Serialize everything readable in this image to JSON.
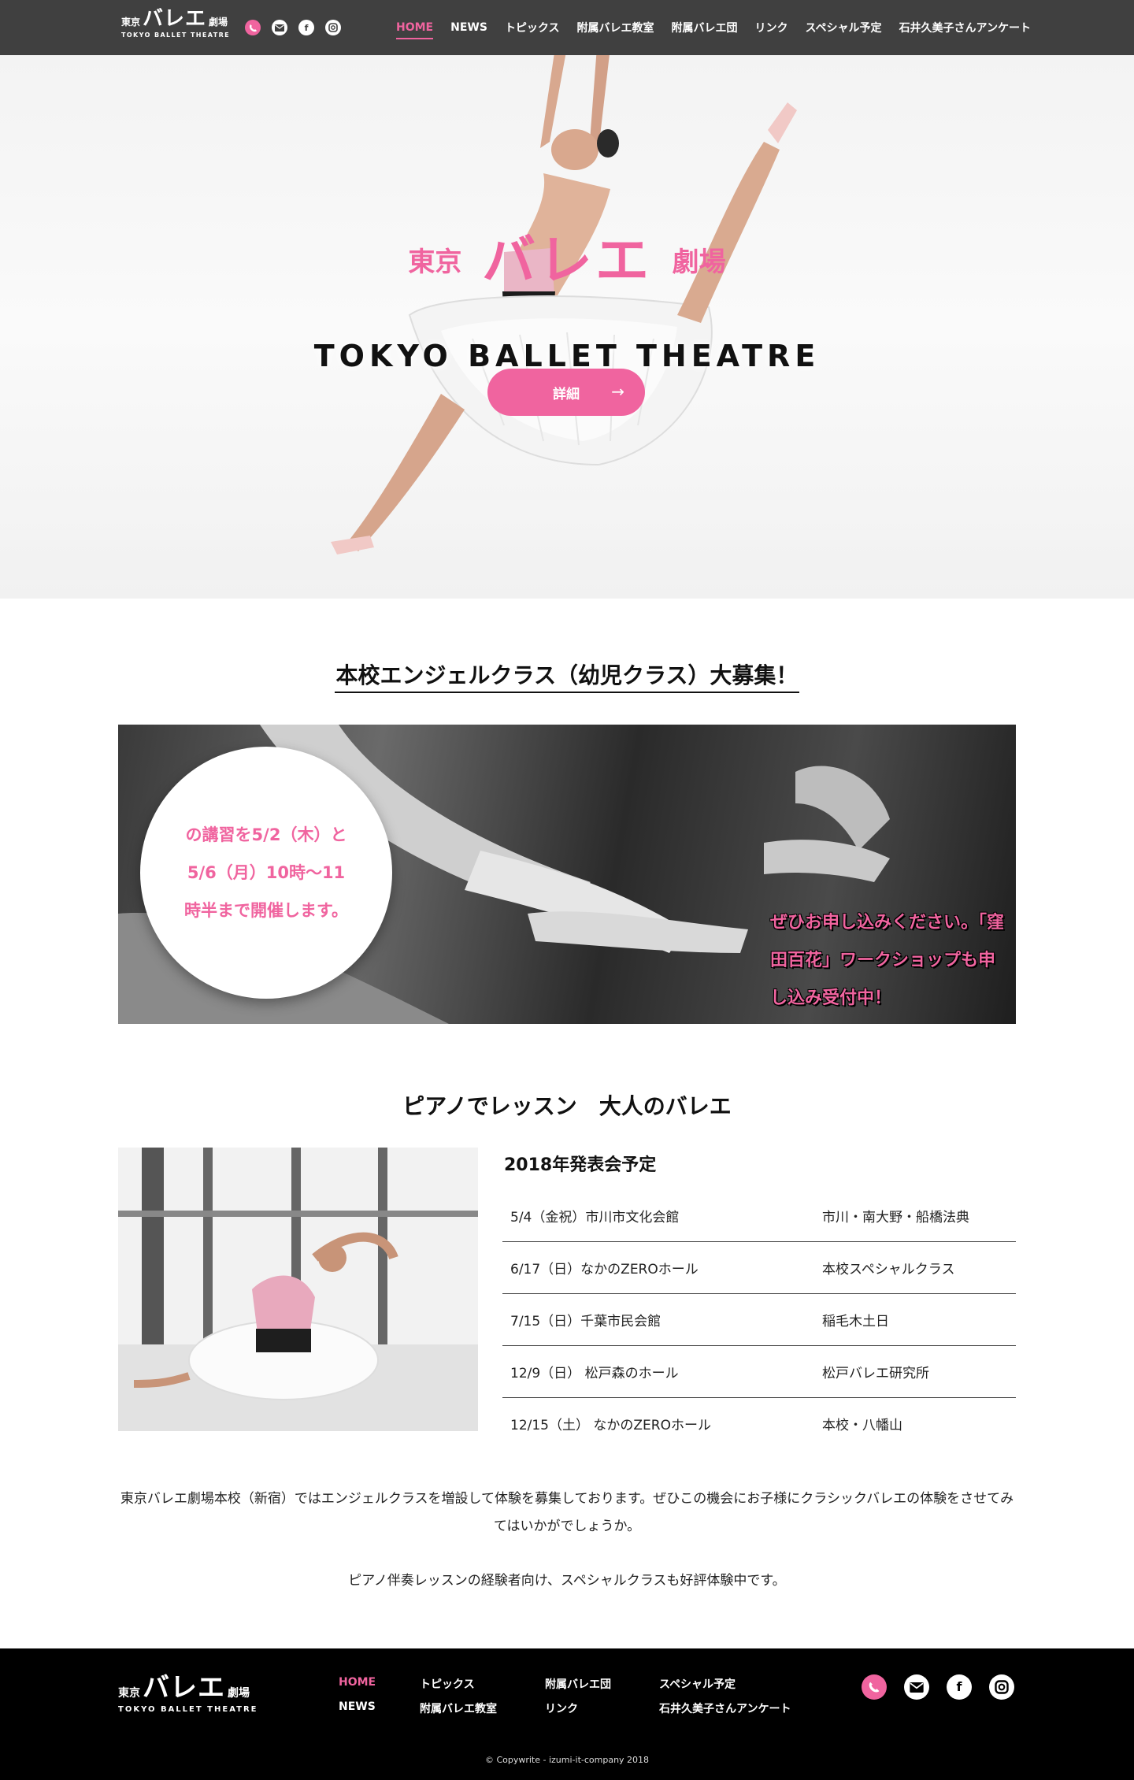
{
  "header": {
    "logo": {
      "prefix": "東京",
      "main": "バレエ",
      "suffix": "劇場",
      "sub": "TOKYO BALLET THEATRE"
    },
    "social_icons": [
      "line-icon",
      "mail-icon",
      "facebook-icon",
      "instagram-icon"
    ],
    "nav": [
      {
        "label": "HOME",
        "active": true
      },
      {
        "label": "NEWS"
      },
      {
        "label": "トピックス"
      },
      {
        "label": "附属バレエ教室"
      },
      {
        "label": "附属バレエ団"
      },
      {
        "label": "リンク"
      },
      {
        "label": "スペシャル予定"
      },
      {
        "label": "石井久美子さんアンケート"
      }
    ]
  },
  "hero": {
    "title_prefix": "東京",
    "title_main": "バレエ",
    "title_suffix": "劇場",
    "title_en": "TOKYO BALLET THEATRE",
    "button_label": "詳細",
    "button_arrow": "→"
  },
  "angel": {
    "title": "本校エンジェルクラス（幼児クラス）大募集！",
    "circle_text": "の講習を5/2（木）と5/6（月）10時～11時半まで開催します。",
    "right_text": "ぜひお申し込みください。「窪田百花」ワークショップも申し込み受付中！"
  },
  "piano": {
    "title": "ピアノでレッスン　大人のバレエ",
    "schedule_title": "2018年発表会予定",
    "schedule": [
      {
        "date": "5/4（金祝）市川市文化会館",
        "place": "市川・南大野・船橋法典"
      },
      {
        "date": "6/17（日）なかのZEROホール",
        "place": "本校スペシャルクラス"
      },
      {
        "date": "7/15（日）千葉市民会館",
        "place": "稲毛木土日"
      },
      {
        "date": "12/9（日） 松戸森のホール",
        "place": "松戸バレエ研究所"
      },
      {
        "date": "12/15（土） なかのZEROホール",
        "place": "本校・八幡山"
      }
    ]
  },
  "body_text": {
    "p1": "東京バレエ劇場本校（新宿）ではエンジェルクラスを増設して体験を募集しております。ぜひこの機会にお子様にクラシックバレエの体験をさせてみてはいかがでしょうか。",
    "p2": "ピアノ伴奏レッスンの経験者向け、スペシャルクラスも好評体験中です。"
  },
  "footer": {
    "logo": {
      "prefix": "東京",
      "main": "バレエ",
      "suffix": "劇場",
      "sub": "TOKYO BALLET THEATRE"
    },
    "links": {
      "home": "HOME",
      "news": "NEWS",
      "topics": "トピックス",
      "school": "附属バレエ教室",
      "company": "附属バレエ団",
      "link": "リンク",
      "special": "スペシャル予定",
      "survey": "石井久美子さんアンケート"
    },
    "social_icons": [
      "line-icon",
      "mail-icon",
      "facebook-icon",
      "instagram-icon"
    ],
    "copyright": "© Copywrite - izumi-it-company 2018"
  },
  "colors": {
    "accent": "#f0649f",
    "header_bg": "#404040",
    "footer_bg": "#000000"
  }
}
